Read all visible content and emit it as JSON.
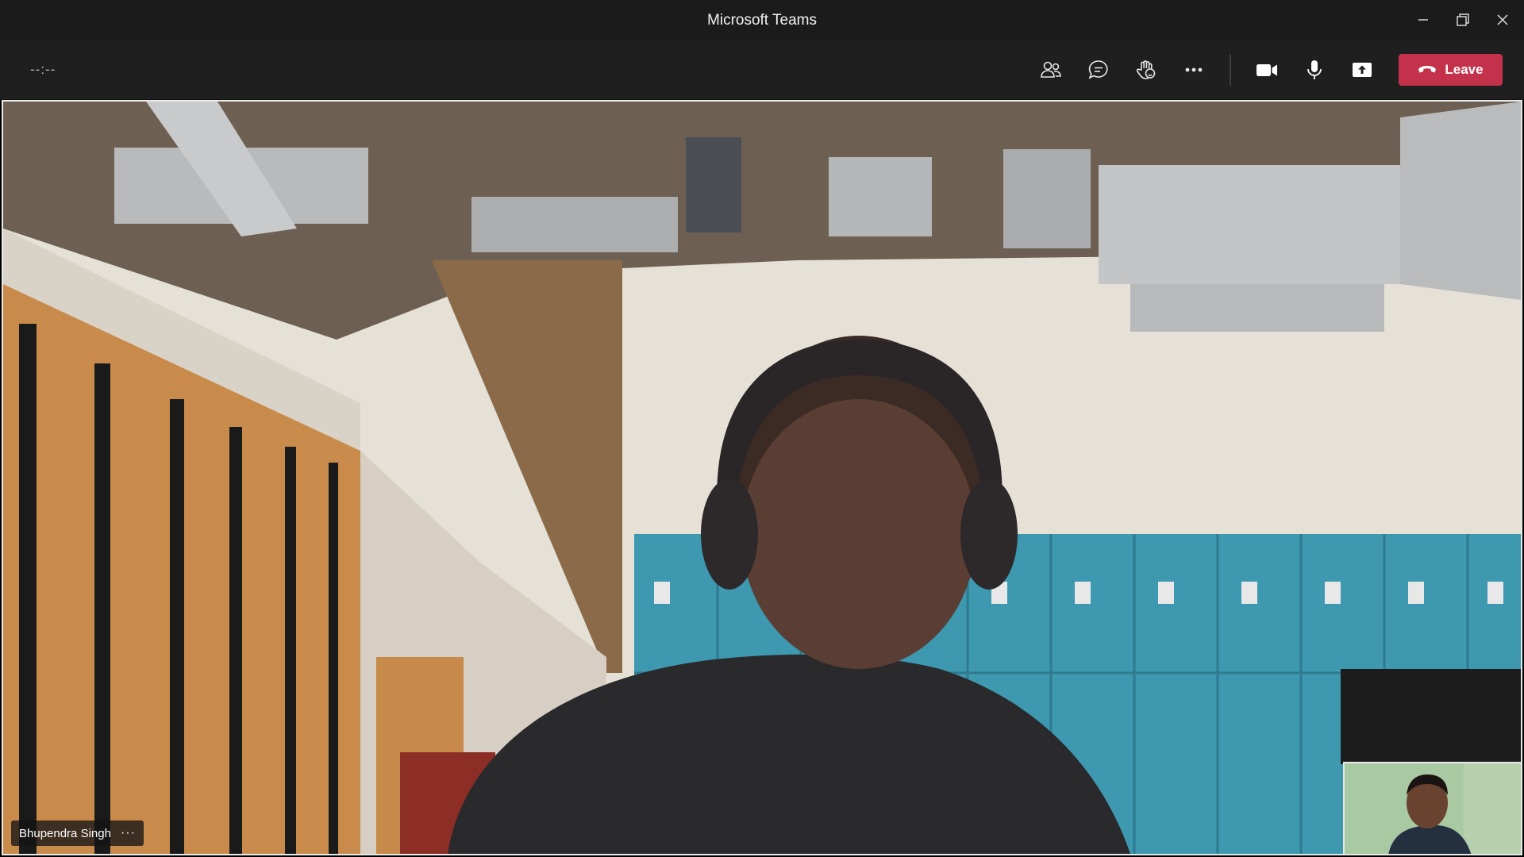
{
  "window": {
    "title": "Microsoft Teams",
    "controls": [
      "minimize-icon",
      "restore-icon",
      "close-icon"
    ]
  },
  "toolbar": {
    "timer": "--:--",
    "buttons": [
      "participants-icon",
      "chat-icon",
      "raise-hand-icon",
      "more-options-icon",
      "camera-icon",
      "microphone-icon",
      "share-screen-icon"
    ],
    "leave_label": "Leave",
    "leave_color": "#c4314b"
  },
  "stage": {
    "participant_name": "Bhupendra Singh",
    "participant_menu": "···"
  },
  "colors": {
    "titlebar": "#1b1b1b",
    "toolbar": "#1f1f1f",
    "lockers": "#3d98b0",
    "wall": "#e6e1d6"
  }
}
